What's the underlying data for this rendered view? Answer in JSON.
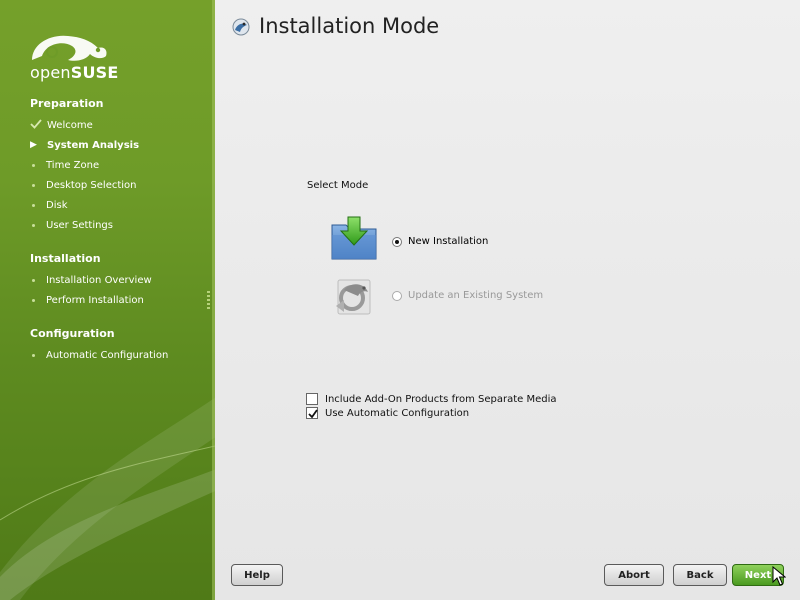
{
  "sidebar": {
    "logo": {
      "text_light": "open",
      "text_bold": "SUSE",
      "icon": "gecko-logo-icon"
    },
    "sections": [
      {
        "title": "Preparation"
      },
      {
        "title": "Installation"
      },
      {
        "title": "Configuration"
      }
    ],
    "steps": [
      {
        "label": "Welcome",
        "state": "done"
      },
      {
        "label": "System Analysis",
        "state": "current"
      },
      {
        "label": "Time Zone",
        "state": "pending"
      },
      {
        "label": "Desktop Selection",
        "state": "pending"
      },
      {
        "label": "Disk",
        "state": "pending"
      },
      {
        "label": "User Settings",
        "state": "pending"
      },
      {
        "label": "Installation Overview",
        "state": "pending"
      },
      {
        "label": "Perform Installation",
        "state": "pending"
      },
      {
        "label": "Automatic Configuration",
        "state": "pending"
      }
    ],
    "colors": {
      "top": "#75a02a",
      "bottom": "#4f7a17"
    }
  },
  "main": {
    "title": "Installation Mode",
    "group_label": "Select Mode",
    "options": [
      {
        "label": "New Installation",
        "selected": true,
        "enabled": true,
        "icon": "folder-download-icon"
      },
      {
        "label": "Update an Existing System",
        "selected": false,
        "enabled": false,
        "icon": "gecko-update-icon"
      }
    ],
    "checkboxes": [
      {
        "label": "Include Add-On Products from Separate Media",
        "checked": false
      },
      {
        "label": "Use Automatic Configuration",
        "checked": true
      }
    ]
  },
  "buttons": {
    "help": "Help",
    "abort": "Abort",
    "back": "Back",
    "next": "Next"
  },
  "accent": "#4a9a1f"
}
